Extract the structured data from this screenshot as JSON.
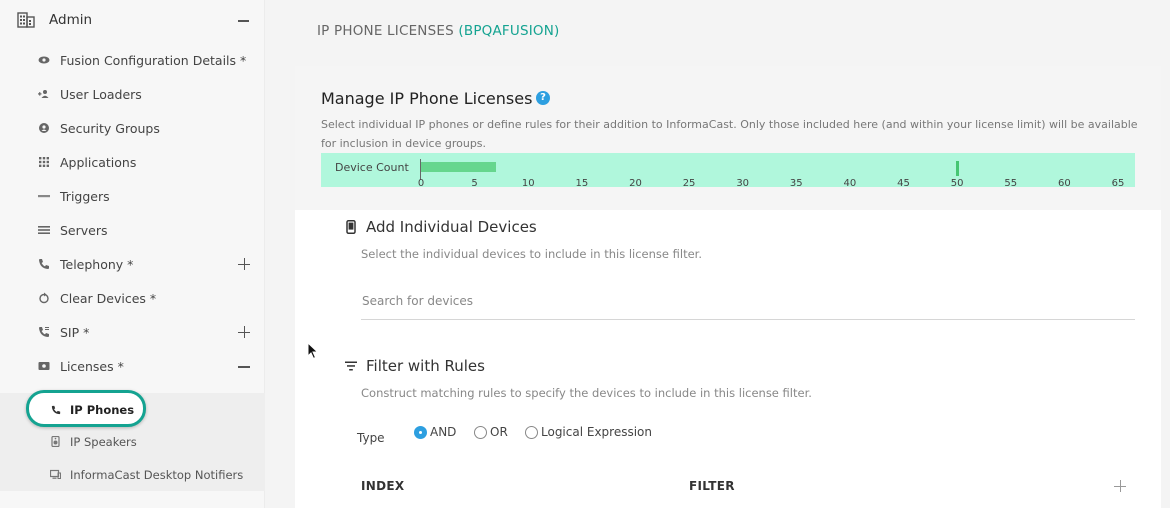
{
  "sidebar": {
    "header": "Admin",
    "items": [
      {
        "label": "Fusion Configuration Details *",
        "icon": "eye-icon"
      },
      {
        "label": "User Loaders",
        "icon": "user-add-icon"
      },
      {
        "label": "Security Groups",
        "icon": "security-group-icon"
      },
      {
        "label": "Applications",
        "icon": "apps-grid-icon"
      },
      {
        "label": "Triggers",
        "icon": "http-icon"
      },
      {
        "label": "Servers",
        "icon": "servers-list-icon"
      },
      {
        "label": "Telephony *",
        "icon": "phone-icon"
      },
      {
        "label": "Clear Devices *",
        "icon": "clear-icon"
      },
      {
        "label": "SIP *",
        "icon": "sip-phone-icon"
      },
      {
        "label": "Licenses *",
        "icon": "license-icon"
      }
    ],
    "sub_items": [
      {
        "label": "IP Phones",
        "icon": "phone-icon"
      },
      {
        "label": "IP Speakers",
        "icon": "speaker-icon"
      },
      {
        "label": "InformaCast Desktop Notifiers",
        "icon": "desktop-icon"
      }
    ]
  },
  "page": {
    "title": "IP PHONE LICENSES",
    "title_accent": "(BPQAFUSION)"
  },
  "manage": {
    "title": "Manage IP Phone Licenses",
    "help": "?",
    "description": "Select individual IP phones or define rules for their addition to InformaCast. Only those included here (and within your license limit) will be available for inclusion in device groups."
  },
  "device_count": {
    "label": "Device Count",
    "value": 7,
    "limit": 50,
    "max": 67,
    "ticks": [
      0,
      5,
      10,
      15,
      20,
      25,
      30,
      35,
      40,
      45,
      50,
      55,
      60,
      65
    ]
  },
  "individual": {
    "title": "Add Individual Devices",
    "description": "Select the individual devices to include in this license filter.",
    "search_placeholder": "Search for devices"
  },
  "rules": {
    "title": "Filter with Rules",
    "description": "Construct matching rules to specify the devices to include in this license filter.",
    "type_label": "Type",
    "options": [
      "AND",
      "OR",
      "Logical Expression"
    ],
    "selected": "AND",
    "columns": [
      "INDEX",
      "FILTER"
    ]
  },
  "colors": {
    "accent": "#14a391",
    "bar_bg": "#b0f7dc",
    "bar_fill": "#66d68e",
    "help": "#2d9fe0"
  }
}
